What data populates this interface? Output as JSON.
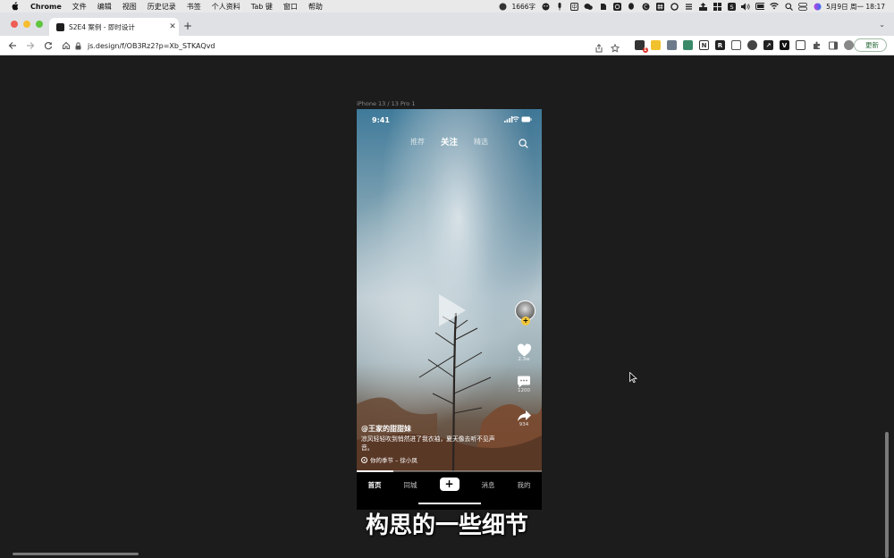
{
  "menubar": {
    "app": "Chrome",
    "items": [
      "文件",
      "编辑",
      "视图",
      "历史记录",
      "书签",
      "个人资料",
      "Tab 键",
      "窗口",
      "帮助"
    ],
    "word_count": "1666字",
    "datetime": "5月9日 周一  18:17"
  },
  "browser": {
    "tab_title": "S2E4 案例 - 即时设计",
    "url": "js.design/f/OB3Rz2?p=Xb_STKAQvd",
    "update_label": "更新",
    "ext_badge": "1"
  },
  "canvas": {
    "frame_label": "iPhone 13 / 13 Pro 1"
  },
  "phone": {
    "time": "9:41",
    "tabs": [
      {
        "label": "推荐",
        "active": false
      },
      {
        "label": "关注",
        "active": true
      },
      {
        "label": "精选",
        "active": false
      }
    ],
    "likes": "2.3w",
    "comments": "1200",
    "shares": "934",
    "username": "@王家的甜甜妹",
    "description": "凉风轻轻吹到悄然进了我衣袖，夏天像去听不见声音。",
    "music": "你的季节 – 徐小凤",
    "progress": 0.2,
    "bottom_nav": [
      {
        "label": "首页",
        "active": true
      },
      {
        "label": "同城",
        "active": false
      },
      {
        "label": "+",
        "active": false,
        "plus": true
      },
      {
        "label": "消息",
        "active": false
      },
      {
        "label": "我的",
        "active": false
      }
    ]
  },
  "video_subtitle": "构思的一些细节"
}
